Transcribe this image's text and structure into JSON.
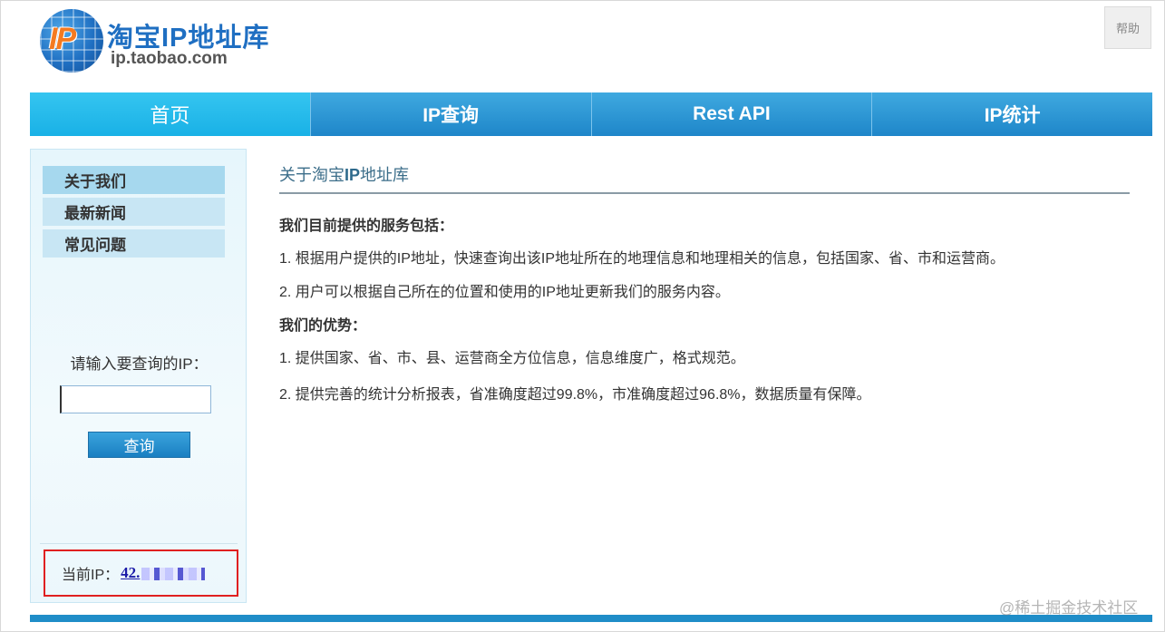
{
  "header": {
    "logo_badge": "IP",
    "logo_title": "淘宝IP地址库",
    "logo_subtitle": "ip.taobao.com",
    "help_label": "帮助"
  },
  "nav": {
    "items": [
      {
        "label": "首页",
        "active": true
      },
      {
        "label": "IP查询",
        "active": false
      },
      {
        "label": "Rest API",
        "active": false
      },
      {
        "label": "IP统计",
        "active": false
      }
    ]
  },
  "sidebar": {
    "items": [
      {
        "label": "关于我们",
        "active": true
      },
      {
        "label": "最新新闻",
        "active": false
      },
      {
        "label": "常见问题",
        "active": false
      }
    ],
    "query_label": "请输入要查询的IP：",
    "query_value": "",
    "query_button": "查询",
    "current_ip_label": "当前IP：",
    "current_ip_value": "42."
  },
  "content": {
    "title_prefix": "关于淘宝",
    "title_bold": "IP",
    "title_suffix": "地址库",
    "services_heading": "我们目前提供的服务包括：",
    "service_1": "1. 根据用户提供的IP地址，快速查询出该IP地址所在的地理信息和地理相关的信息，包括国家、省、市和运营商。",
    "service_2": "2. 用户可以根据自己所在的位置和使用的IP地址更新我们的服务内容。",
    "advantages_heading": "我们的优势：",
    "advantage_1": "1. 提供国家、省、市、县、运营商全方位信息，信息维度广，格式规范。",
    "advantage_2": "2. 提供完善的统计分析报表，省准确度超过99.8%，市准确度超过96.8%，数据质量有保障。"
  },
  "footer": {
    "watermark": "@稀土掘金技术社区"
  },
  "colors": {
    "nav_blue": "#1e86c9",
    "nav_active": "#19b1e6",
    "highlight_red": "#e02020"
  }
}
